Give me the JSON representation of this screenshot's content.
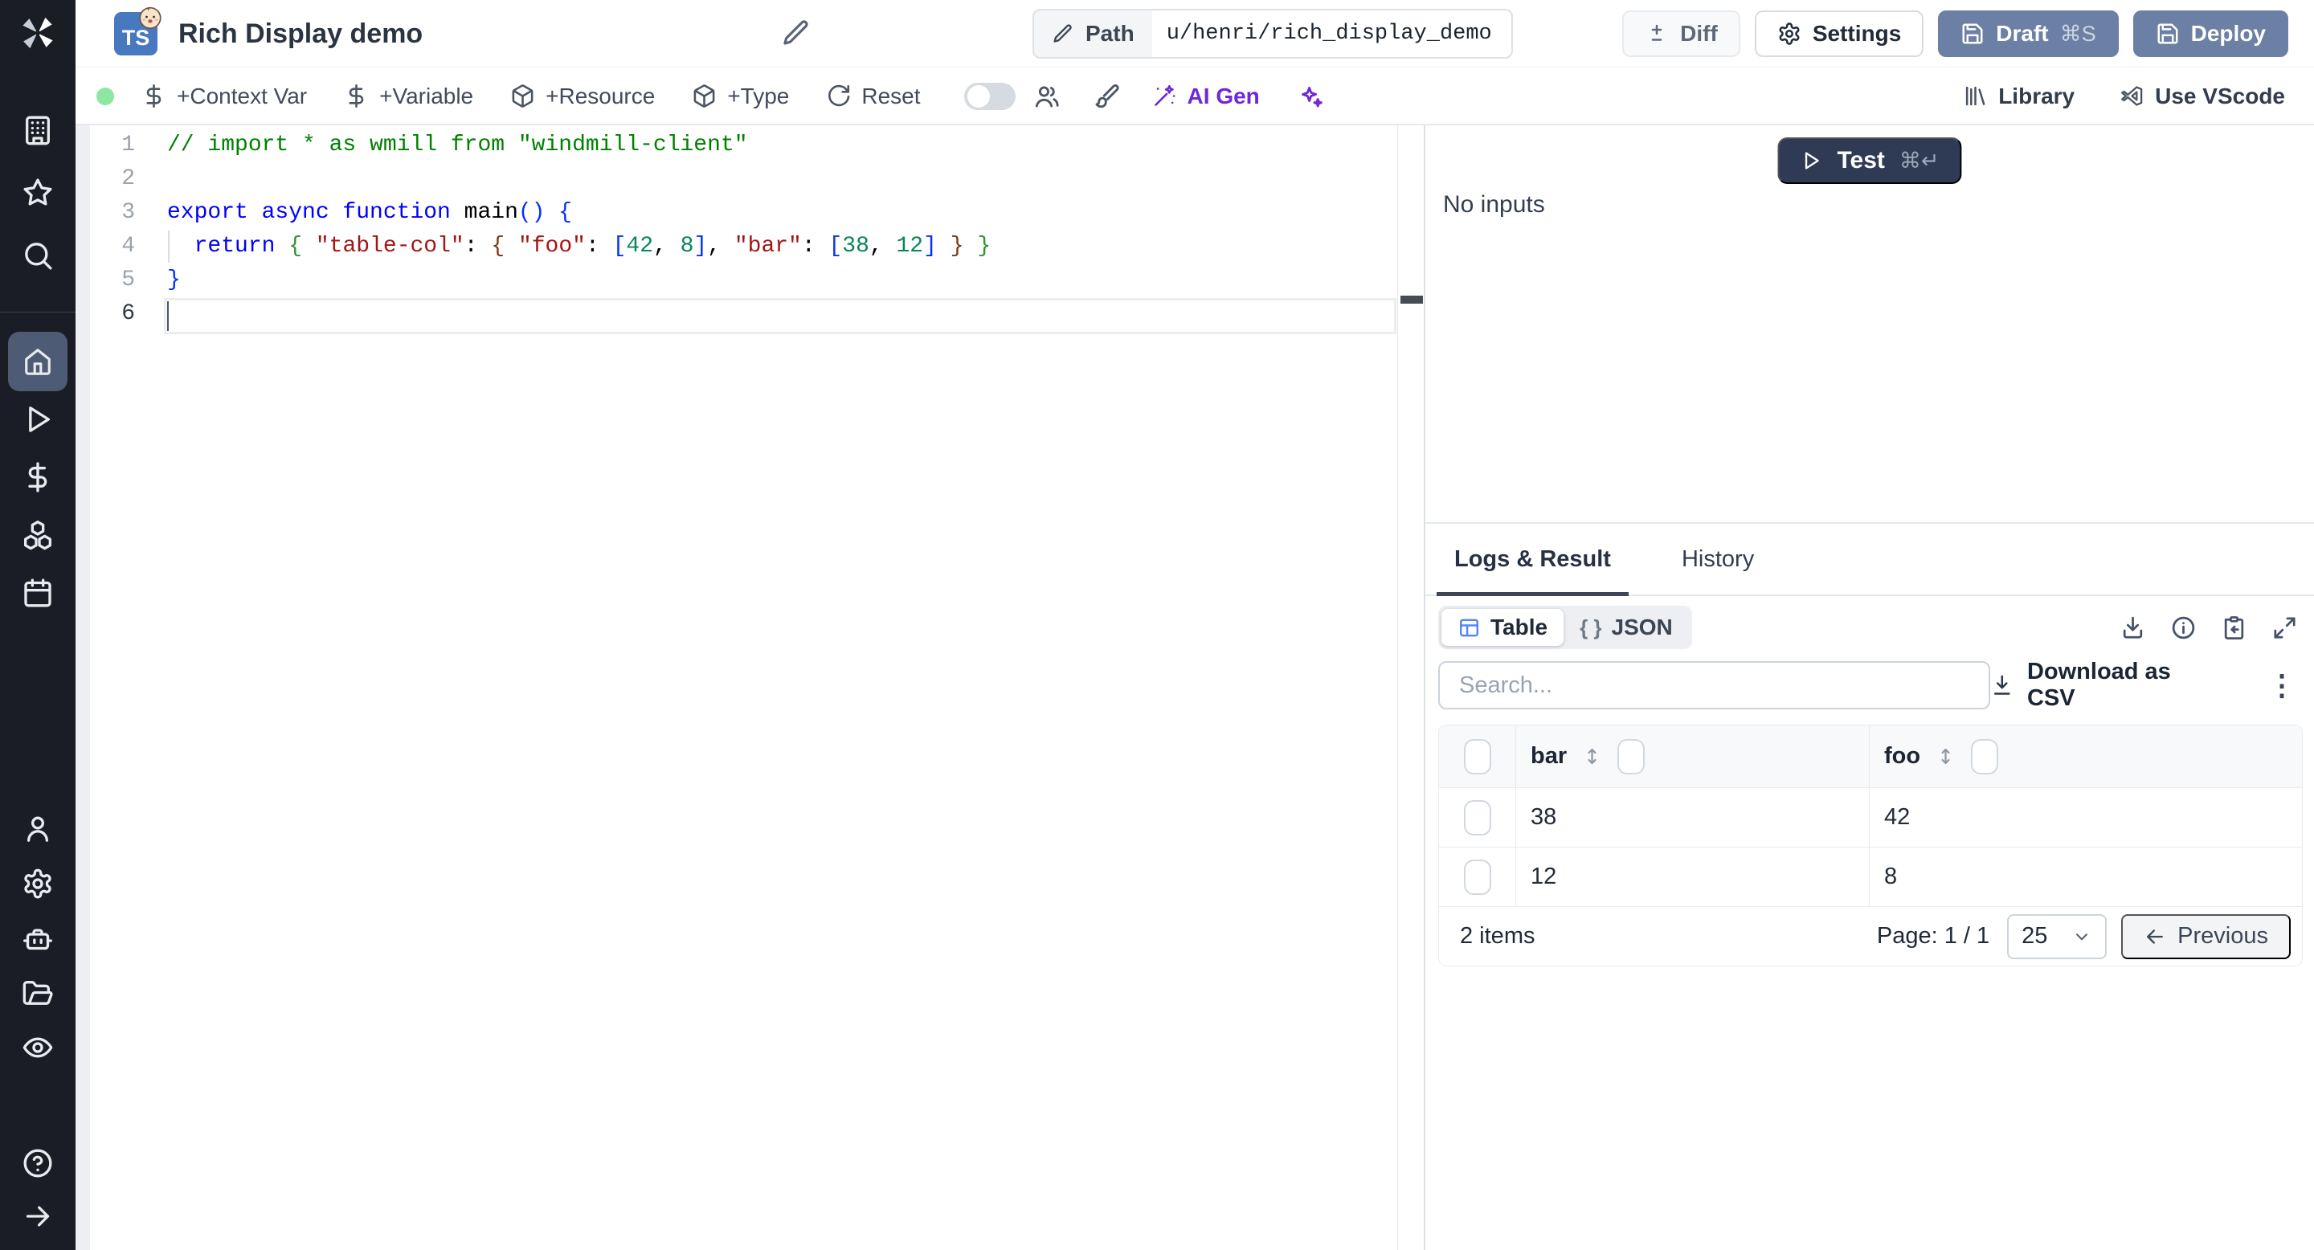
{
  "app": {
    "name": "Windmill"
  },
  "sidebar": {
    "items": [
      {
        "name": "workspace"
      },
      {
        "name": "favorites"
      },
      {
        "name": "search"
      },
      {
        "name": "home",
        "active": true
      },
      {
        "name": "runs"
      },
      {
        "name": "variables"
      },
      {
        "name": "resources"
      },
      {
        "name": "schedules"
      },
      {
        "name": "users"
      },
      {
        "name": "settings"
      },
      {
        "name": "workers"
      },
      {
        "name": "folders"
      },
      {
        "name": "audit-logs"
      },
      {
        "name": "help"
      },
      {
        "name": "expand"
      }
    ]
  },
  "header": {
    "lang_badge": "TS",
    "emoji_badge": "baby-face",
    "title": "Rich Display demo",
    "path_label": "Path",
    "path_value": "u/henri/rich_display_demo",
    "diff_label": "Diff",
    "settings_label": "Settings",
    "draft_label": "Draft",
    "draft_shortcut": "⌘S",
    "deploy_label": "Deploy"
  },
  "toolbar": {
    "items": [
      {
        "label": "+Context Var"
      },
      {
        "label": "+Variable"
      },
      {
        "label": "+Resource"
      },
      {
        "label": "+Type"
      },
      {
        "label": "Reset"
      }
    ],
    "ai_gen_label": "AI Gen",
    "library_label": "Library",
    "vscode_label": "Use VScode"
  },
  "editor": {
    "lines": [
      {
        "num": "1",
        "segments": [
          {
            "t": "// import * as wmill from \"windmill-client\"",
            "c": "comment"
          }
        ]
      },
      {
        "num": "2",
        "segments": []
      },
      {
        "num": "3",
        "segments": [
          {
            "t": "export async function",
            "c": "kw"
          },
          {
            "t": " main",
            "c": "fn"
          },
          {
            "t": "() {",
            "c": "b1"
          }
        ]
      },
      {
        "num": "4",
        "segments": [
          {
            "t": "  ",
            "c": "pl"
          },
          {
            "t": "return",
            "c": "kw"
          },
          {
            "t": " ",
            "c": "pl"
          },
          {
            "t": "{",
            "c": "b2"
          },
          {
            "t": " ",
            "c": "pl"
          },
          {
            "t": "\"table-col\"",
            "c": "str"
          },
          {
            "t": ": ",
            "c": "pl"
          },
          {
            "t": "{",
            "c": "b3"
          },
          {
            "t": " ",
            "c": "pl"
          },
          {
            "t": "\"foo\"",
            "c": "str"
          },
          {
            "t": ": ",
            "c": "pl"
          },
          {
            "t": "[",
            "c": "b1"
          },
          {
            "t": "42",
            "c": "num"
          },
          {
            "t": ", ",
            "c": "pl"
          },
          {
            "t": "8",
            "c": "num"
          },
          {
            "t": "]",
            "c": "b1"
          },
          {
            "t": ", ",
            "c": "pl"
          },
          {
            "t": "\"bar\"",
            "c": "str"
          },
          {
            "t": ": ",
            "c": "pl"
          },
          {
            "t": "[",
            "c": "b1"
          },
          {
            "t": "38",
            "c": "num"
          },
          {
            "t": ", ",
            "c": "pl"
          },
          {
            "t": "12",
            "c": "num"
          },
          {
            "t": "]",
            "c": "b1"
          },
          {
            "t": " ",
            "c": "pl"
          },
          {
            "t": "}",
            "c": "b3"
          },
          {
            "t": " ",
            "c": "pl"
          },
          {
            "t": "}",
            "c": "b2"
          }
        ]
      },
      {
        "num": "5",
        "segments": [
          {
            "t": "}",
            "c": "b1"
          }
        ]
      },
      {
        "num": "6",
        "active": true,
        "segments": []
      }
    ]
  },
  "run_panel": {
    "test_label": "Test",
    "test_shortcut": "⌘↵",
    "no_inputs": "No inputs"
  },
  "result_panel": {
    "tabs": [
      {
        "label": "Logs & Result",
        "active": true
      },
      {
        "label": "History",
        "active": false
      }
    ],
    "view_toggle": {
      "table_label": "Table",
      "json_label": "JSON"
    },
    "search_placeholder": "Search...",
    "download_csv_label": "Download as CSV",
    "table": {
      "columns": [
        "bar",
        "foo"
      ],
      "rows": [
        [
          "38",
          "42"
        ],
        [
          "12",
          "8"
        ]
      ],
      "items_count": "2 items",
      "page_info": "Page: 1 / 1",
      "page_size": "25",
      "prev_label": "Previous"
    }
  },
  "icons": {
    "kebab": "⋮",
    "json_braces": "{ }"
  },
  "colors": {
    "accent_slate": "#6b80a4",
    "test_navy": "#2f3b54",
    "sidebar_bg": "#1a1d25",
    "active_nav": "#4d5c74",
    "ai_purple": "#6d28d9",
    "status_green": "#8ee6a3",
    "table_icon_blue": "#5585f2"
  }
}
